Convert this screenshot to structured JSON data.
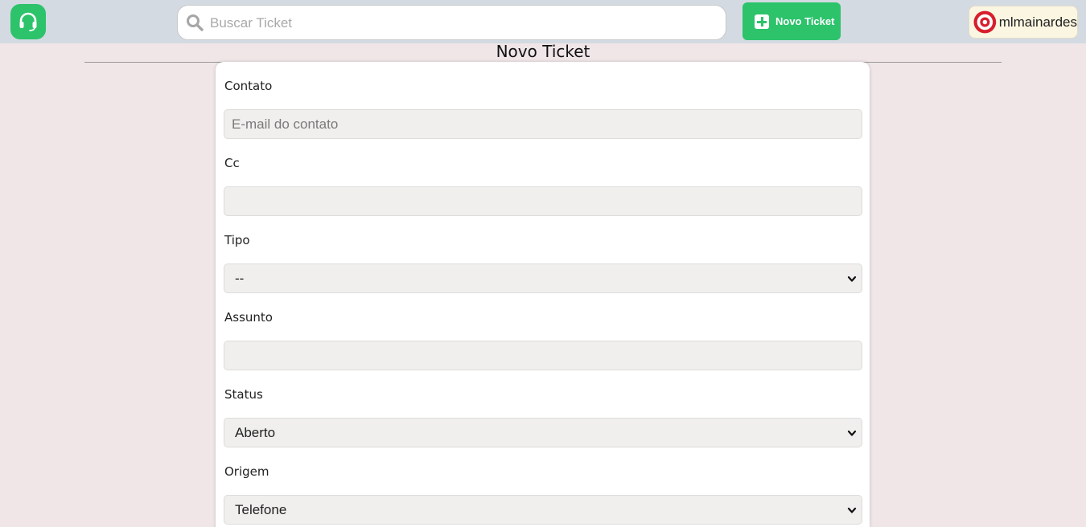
{
  "header": {
    "search": {
      "placeholder": "Buscar Ticket",
      "value": ""
    },
    "new_ticket_label": "Novo Ticket",
    "username": "mlmainardes"
  },
  "page": {
    "title": "Novo Ticket"
  },
  "form": {
    "contato": {
      "label": "Contato",
      "placeholder": "E-mail do contato",
      "value": ""
    },
    "cc": {
      "label": "Cc",
      "value": ""
    },
    "tipo": {
      "label": "Tipo",
      "selected": "--"
    },
    "assunto": {
      "label": "Assunto",
      "value": ""
    },
    "status": {
      "label": "Status",
      "selected": "Aberto"
    },
    "origem": {
      "label": "Origem",
      "selected": "Telefone"
    }
  },
  "colors": {
    "accent": "#2cc36b",
    "topbar": "#d3dae1",
    "background": "#f0e6e8",
    "field": "#f0efee",
    "avatar_ring": "#d71f2d"
  },
  "icons": {
    "logo": "headset-icon",
    "search": "search-icon",
    "new_ticket": "plus-icon",
    "avatar": "target-icon",
    "select": "chevron-down-icon"
  }
}
